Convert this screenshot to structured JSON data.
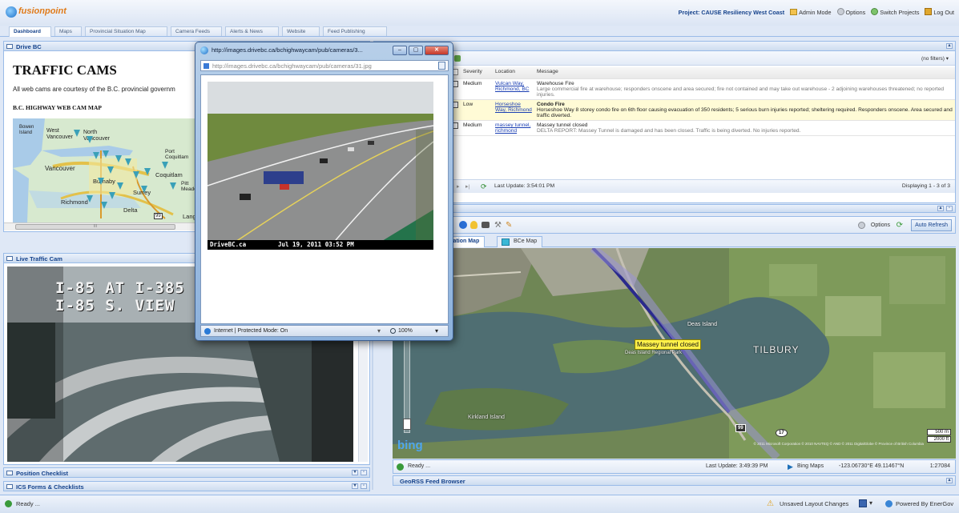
{
  "app": {
    "logo_text": "fusionpoint"
  },
  "header": {
    "project_label": "Project: CAUSE Resiliency West Coast",
    "admin_mode": "Admin Mode",
    "options": "Options",
    "switch_projects": "Switch Projects",
    "log_out": "Log Out"
  },
  "tabs": [
    "Dashboard",
    "Maps",
    "Provincial Situation Map",
    "Camera Feeds",
    "Alerts & News",
    "Website",
    "Feed Publishing"
  ],
  "drivebc": {
    "panel_title": "Drive BC",
    "heading": "TRAFFIC CAMS",
    "intro": "All web cams are courtesy of the B.C. provincial governm",
    "map_title": "B.C. HIGHWAY WEB CAM MAP",
    "places": [
      "Bowen Island",
      "West Vancouver",
      "North Vancouver",
      "Burnaby",
      "Vancouver",
      "Richmond",
      "Surrey",
      "Coquitlam",
      "Delta",
      "Port Coquitlam",
      "Pitt Meadows",
      "Langley"
    ],
    "route_marker": "99",
    "scroll_mark": "III"
  },
  "live_cam": {
    "panel_title": "Live Traffic Cam",
    "overlay_line1": "I-85 AT I-385",
    "overlay_line2": "I-85 S. VIEW"
  },
  "ie_popup": {
    "title": "http://images.drivebc.ca/bchighwaycam/pub/cameras/3...",
    "address": "http://images.drivebc.ca/bchighwaycam/pub/cameras/31.jpg",
    "cam_caption_left": "DriveBC.ca",
    "cam_caption_right": "Jul 19, 2011 03:52 PM",
    "status": "Internet | Protected Mode: On",
    "zoom": "100%"
  },
  "alerts": {
    "filters": "(no filters)",
    "columns": [
      "Severity",
      "Location",
      "Message"
    ],
    "rows": [
      {
        "severity": "Medium",
        "location": "Vulcan Way, Richmond, BC",
        "title": "Warehouse Fire",
        "body": "Large commercial fire at warehouse; responders onscene and area secured; fire not contained and may take out warehouse - 2 adjoining warehouses threatened; no reported injuries."
      },
      {
        "severity": "Low",
        "location": "Horseshoe Way, Richmond",
        "title": "Condo Fire",
        "body": "Horseshoe Way 8 storey condo fire on 6th floor causing evacuation of 350 residents; 5 serious burn injuries reported; sheltering required. Responders onscene. Area secured and traffic diverted."
      },
      {
        "severity": "Medium",
        "location": "massey tunnel, richmond",
        "title": "Massey tunnel closed",
        "body": "DELTA REPORT: Massey Tunnel is damaged and has been closed. Traffic is being diverted. No injuries reported."
      }
    ],
    "last_update": "Last Update: 3:54:01 PM",
    "displaying": "Displaying 1 - 3 of 3"
  },
  "map_panel": {
    "options": "Options",
    "auto_refresh": "Auto Refresh",
    "tab_situation": "ituation Map",
    "tab_bce": "BCe Map",
    "labels": {
      "deas": "Deas Island",
      "deas_park": "Deas Island Regional Park",
      "tilbury": "TILBURY",
      "kirkland": "Kirkland Island",
      "massey_callout": "Massey tunnel closed",
      "shield_99": "99",
      "shield_17": "17"
    },
    "scale_m": "500 m",
    "scale_ft": "2000 ft",
    "bing": "bing",
    "copyright": "© 2011 Microsoft Corporation  © 2010 NAVTEQ  © AND  © 2011 DigitalGlobe  © Province of British Columbia",
    "ready": "Ready ...",
    "last_update": "Last Update: 3:49:39 PM",
    "bing_maps": "Bing Maps",
    "coords": "-123.06730°E 49.11467°N",
    "scale_ratio": "1:27084",
    "georss": "GeoRSS Feed Browser"
  },
  "bottom_panels": [
    "Position Checklist",
    "ICS Forms & Checklists"
  ],
  "status_bar": {
    "ready": "Ready ...",
    "unsaved": "Unsaved Layout Changes",
    "powered": "Powered By EnerGov"
  },
  "colors": {
    "accent": "#15428b",
    "header_bg": "#dfe8f6",
    "row_highlight": "#fffbd6",
    "map_route": "#2a2a8c"
  }
}
